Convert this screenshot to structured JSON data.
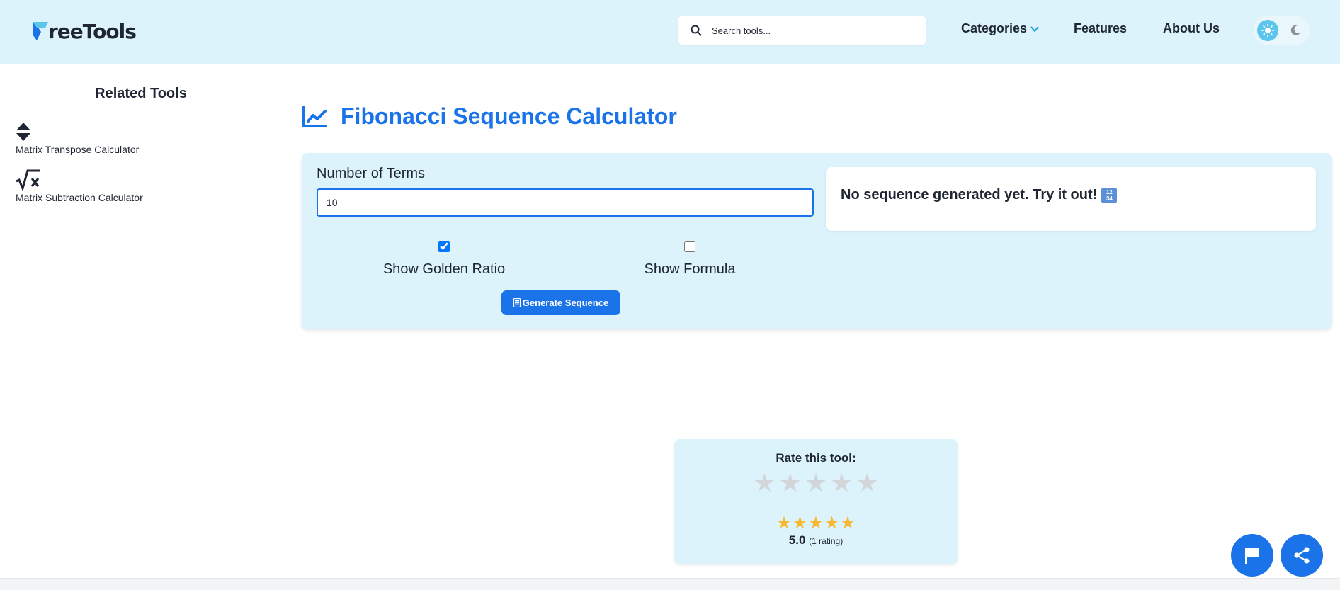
{
  "header": {
    "logo_text": "reeTools",
    "logo_full": "FreeTools",
    "search": {
      "placeholder": "Search tools..."
    },
    "nav": {
      "categories": "Categories",
      "features": "Features",
      "about": "About Us"
    },
    "theme": {
      "light_icon": "sun-icon",
      "dark_icon": "moon-icon"
    }
  },
  "sidebar": {
    "title": "Related Tools",
    "items": [
      {
        "label": "Matrix Transpose Calculator",
        "icon": "sort-arrows-icon"
      },
      {
        "label": "Matrix Subtraction Calculator",
        "icon": "square-root-x-icon"
      }
    ]
  },
  "main": {
    "title": "Fibonacci Sequence Calculator",
    "title_icon": "chart-line-icon",
    "form": {
      "terms_label": "Number of Terms",
      "terms_value": "10",
      "golden_ratio_label": "Show Golden Ratio",
      "golden_ratio_checked": true,
      "formula_label": "Show Formula",
      "formula_checked": false,
      "generate_label": "Generate Sequence",
      "generate_icon": "calculator-icon"
    },
    "result": {
      "message": "No sequence generated yet. Try it out!",
      "emoji": "1234-input-numbers-icon",
      "emoji_digits": [
        "12",
        "34"
      ]
    }
  },
  "rating": {
    "title": "Rate this tool:",
    "input_stars": 5,
    "average_stars": 5,
    "score": "5.0",
    "count_text": "(1 rating)"
  },
  "fabs": {
    "report_icon": "flag-icon",
    "share_icon": "share-icon"
  },
  "colors": {
    "accent": "#1a73e8",
    "header_bg": "#dcf3fb",
    "star_filled": "#f5b82e",
    "star_empty": "#d3d6d8"
  }
}
